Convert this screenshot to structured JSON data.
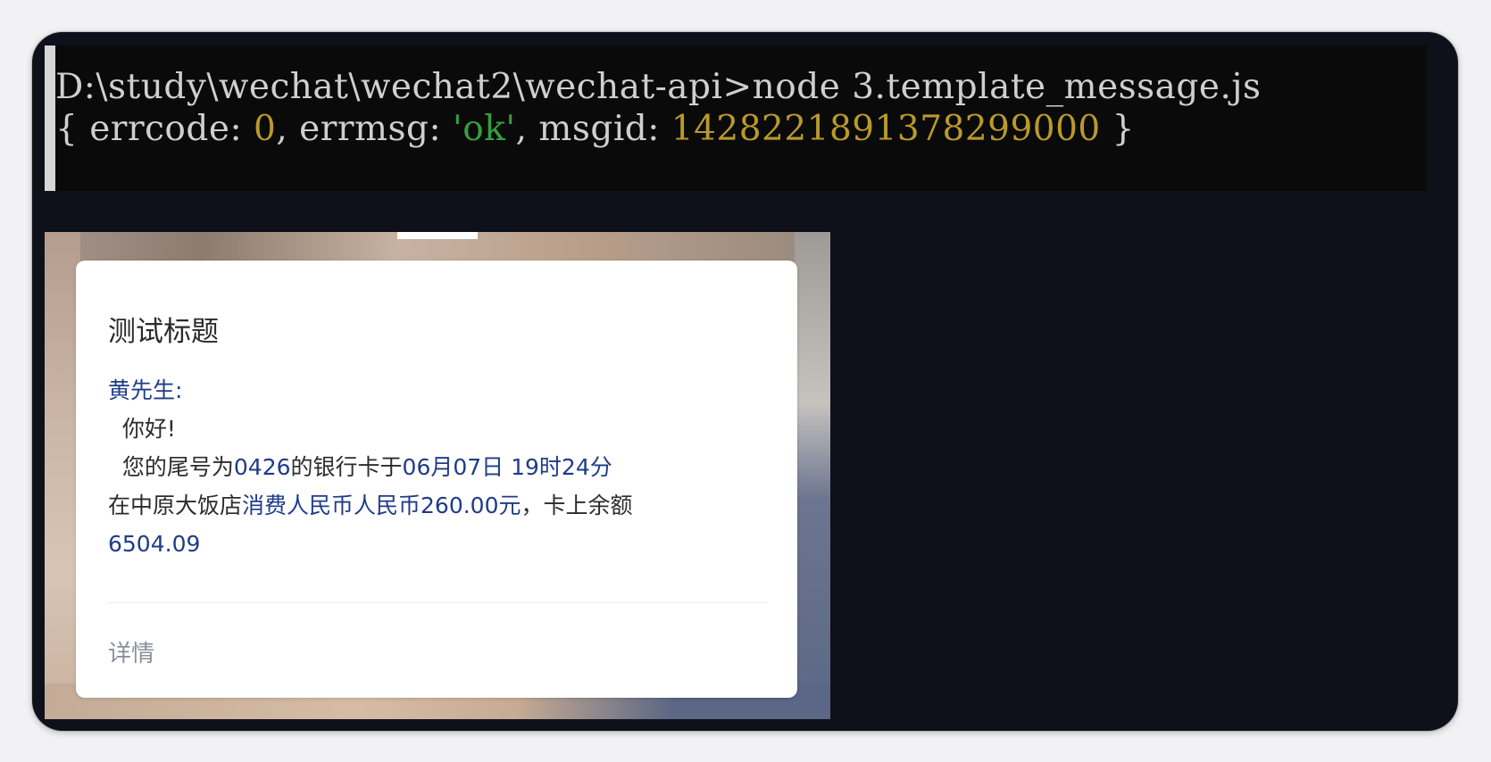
{
  "terminal": {
    "prompt_line": "D:\\study\\wechat\\wechat2\\wechat-api>node 3.template_message.js",
    "output": {
      "open_brace": "{ ",
      "errcode_key": "errcode: ",
      "errcode_value": "0",
      "sep1": ", ",
      "errmsg_key": "errmsg: ",
      "errmsg_value": "'ok'",
      "sep2": ", ",
      "msgid_key": "msgid: ",
      "msgid_value": "1428221891378299000",
      "close_brace": " }"
    }
  },
  "message_card": {
    "title": "测试标题",
    "greeting_name": "黄先生:",
    "greeting": "  你好!",
    "line1_prefix": "  您的尾号为",
    "card_tail": "0426",
    "line1_mid": "的银行卡于",
    "datetime": "06月07日 19时24分",
    "line2_prefix": "在中原大饭店",
    "amount_text": "消费人民币人民币260.00元",
    "line2_suffix": "，卡上余额",
    "balance": "6504.09",
    "detail_link": "详情"
  },
  "colors": {
    "terminal_bg": "#0a0a0a",
    "terminal_text": "#cfcfcf",
    "number": "#b99a2a",
    "string": "#36a03c",
    "frame_bg": "#0e111a",
    "card_bg": "#ffffff",
    "accent_blue": "#1f3c88"
  }
}
